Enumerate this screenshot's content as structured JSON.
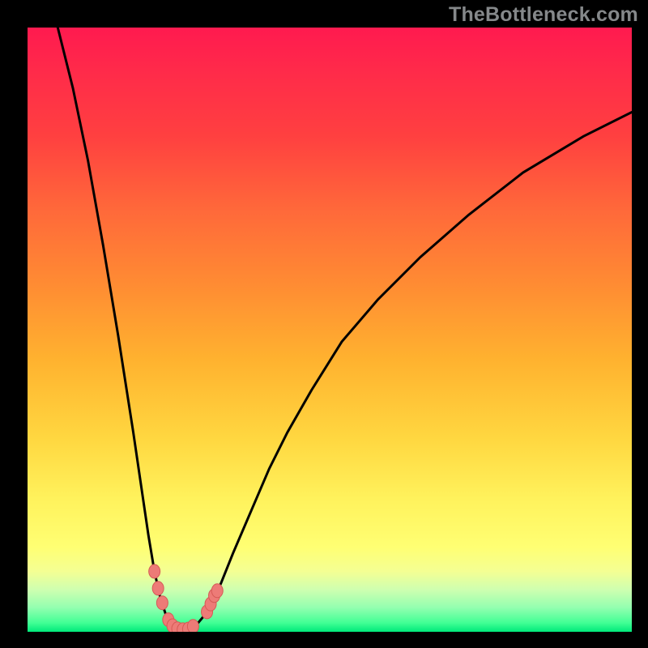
{
  "watermark": {
    "text": "TheBottleneck.com"
  },
  "colors": {
    "background": "#000000",
    "gradient_top": "#ff1a4f",
    "gradient_bottom": "#00e97a",
    "curve_stroke": "#000000",
    "marker_fill": "#ed7b77",
    "marker_stroke": "#d65a56"
  },
  "chart_data": {
    "type": "line",
    "title": "",
    "xlabel": "",
    "ylabel": "",
    "xlim": [
      0,
      100
    ],
    "ylim": [
      0,
      100
    ],
    "series": [
      {
        "name": "bottleneck-curve",
        "x": [
          5,
          7.5,
          10,
          12.5,
          15,
          17.5,
          20,
          21,
          22,
          23,
          24,
          25,
          26,
          27,
          28,
          29,
          30,
          32,
          34,
          37,
          40,
          43,
          47,
          52,
          58,
          65,
          73,
          82,
          92,
          100
        ],
        "y": [
          100,
          90,
          78,
          64,
          49,
          33,
          16,
          10,
          5.5,
          2.5,
          1,
          0.4,
          0.3,
          0.5,
          1.2,
          2.4,
          4,
          8,
          13,
          20,
          27,
          33,
          40,
          48,
          55,
          62,
          69,
          76,
          82,
          86
        ]
      }
    ],
    "markers": [
      {
        "x": 21.0,
        "y": 10.0
      },
      {
        "x": 21.6,
        "y": 7.2
      },
      {
        "x": 22.3,
        "y": 4.8
      },
      {
        "x": 23.3,
        "y": 2.0
      },
      {
        "x": 24.0,
        "y": 1.0
      },
      {
        "x": 24.8,
        "y": 0.5
      },
      {
        "x": 25.7,
        "y": 0.35
      },
      {
        "x": 26.6,
        "y": 0.45
      },
      {
        "x": 27.4,
        "y": 0.9
      },
      {
        "x": 29.7,
        "y": 3.3
      },
      {
        "x": 30.3,
        "y": 4.6
      },
      {
        "x": 30.9,
        "y": 6.0
      },
      {
        "x": 31.4,
        "y": 6.8
      }
    ]
  }
}
